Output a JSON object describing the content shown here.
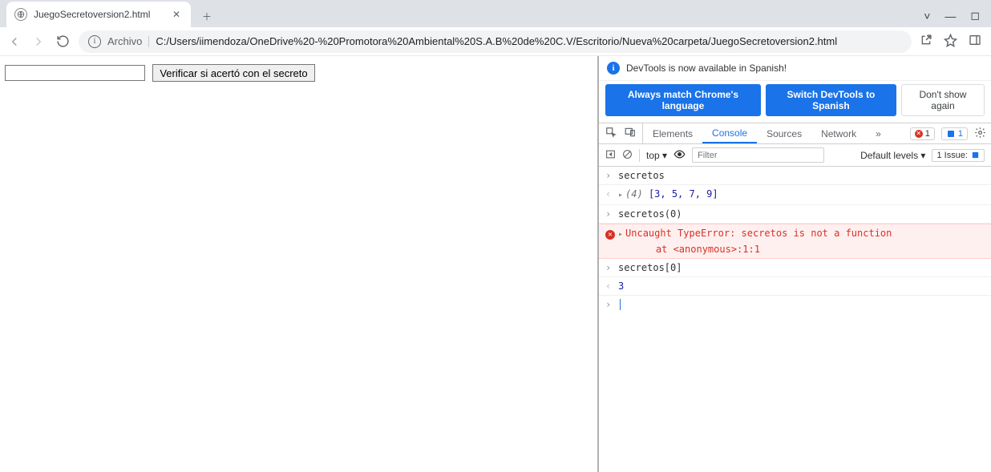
{
  "browser": {
    "tab_title": "JuegoSecretoversion2.html",
    "omnibox_label": "Archivo",
    "url": "C:/Users/iimendoza/OneDrive%20-%20Promotora%20Ambiental%20S.A.B%20de%20C.V/Escritorio/Nueva%20carpeta/JuegoSecretoversion2.html"
  },
  "page": {
    "input_value": "",
    "button_label": "Verificar si acertó con el secreto"
  },
  "devtools": {
    "banner_text": "DevTools is now available in Spanish!",
    "btn_match": "Always match Chrome's language",
    "btn_switch": "Switch DevTools to Spanish",
    "btn_dont": "Don't show again",
    "tabs": {
      "elements": "Elements",
      "console": "Console",
      "sources": "Sources",
      "network": "Network"
    },
    "error_count": "1",
    "issue_count": "1",
    "filter": {
      "context": "top ▾",
      "placeholder": "Filter",
      "levels": "Default levels ▾",
      "issues_label": "1 Issue:"
    },
    "console": {
      "r1_cmd": "secretos",
      "r2_arr_prefix": "(4) ",
      "r2_arr_body": "[3, 5, 7, 9]",
      "r3_cmd": "secretos(0)",
      "r4_err": "Uncaught TypeError: secretos is not a function",
      "r4_err_sub": "    at <anonymous>:1:1",
      "r5_cmd": "secretos[0]",
      "r6_out": "3"
    }
  }
}
